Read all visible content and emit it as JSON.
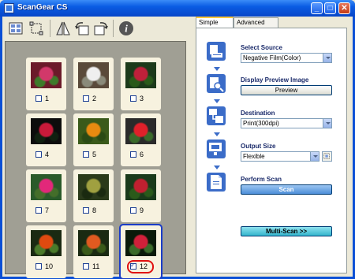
{
  "window": {
    "title": "ScanGear CS",
    "minimize": "_",
    "maximize": "□",
    "close": "✕"
  },
  "toolbar": {
    "tools": [
      {
        "icon": "thumbnail-view-icon"
      },
      {
        "icon": "crop-frame-icon"
      },
      {
        "icon": "mirror-icon"
      },
      {
        "icon": "rotate-left-icon"
      },
      {
        "icon": "rotate-right-icon"
      },
      {
        "icon": "info-icon"
      }
    ]
  },
  "thumbnails": [
    {
      "num": "1",
      "checked": false,
      "colors": [
        "#6b1a2a",
        "#d2386a",
        "#3d7a2a"
      ]
    },
    {
      "num": "2",
      "checked": false,
      "colors": [
        "#5a4a3a",
        "#efefef",
        "#8a8a7a"
      ]
    },
    {
      "num": "3",
      "checked": false,
      "colors": [
        "#1c3a1a",
        "#c0203a",
        "#2a5a1a"
      ]
    },
    {
      "num": "4",
      "checked": false,
      "colors": [
        "#0c0c0c",
        "#c81a3a",
        "#102010"
      ]
    },
    {
      "num": "5",
      "checked": false,
      "colors": [
        "#3a5a1a",
        "#e88a10",
        "#2a4a14"
      ]
    },
    {
      "num": "6",
      "checked": false,
      "colors": [
        "#2a2a2a",
        "#e0202a",
        "#3a6a2a"
      ]
    },
    {
      "num": "7",
      "checked": false,
      "colors": [
        "#2a5a2a",
        "#e2287a",
        "#446e2a"
      ]
    },
    {
      "num": "8",
      "checked": false,
      "colors": [
        "#2a3a1a",
        "#a0a040",
        "#1a2a10"
      ]
    },
    {
      "num": "9",
      "checked": false,
      "colors": [
        "#1a3a1a",
        "#c02030",
        "#2a5a1a"
      ]
    },
    {
      "num": "10",
      "checked": false,
      "colors": [
        "#1a2a12",
        "#e04a10",
        "#4a7a2a"
      ]
    },
    {
      "num": "11",
      "checked": false,
      "colors": [
        "#1a2a12",
        "#e05a20",
        "#3a5a1a"
      ]
    },
    {
      "num": "12",
      "checked": true,
      "colors": [
        "#0a1a0a",
        "#d0203a",
        "#3a6a2a"
      ]
    }
  ],
  "tabs": [
    {
      "label": "Simple Mode",
      "active": true
    },
    {
      "label": "Advanced Mode",
      "active": false
    }
  ],
  "steps": {
    "source": {
      "label": "Select Source",
      "value": "Negative Film(Color)"
    },
    "preview": {
      "label": "Display Preview Image",
      "button": "Preview"
    },
    "destination": {
      "label": "Destination",
      "value": "Print(300dpi)"
    },
    "output": {
      "label": "Output Size",
      "value": "Flexible"
    },
    "scan": {
      "label": "Perform Scan",
      "button": "Scan"
    }
  },
  "multiscan": {
    "button": "Multi-Scan >>"
  }
}
